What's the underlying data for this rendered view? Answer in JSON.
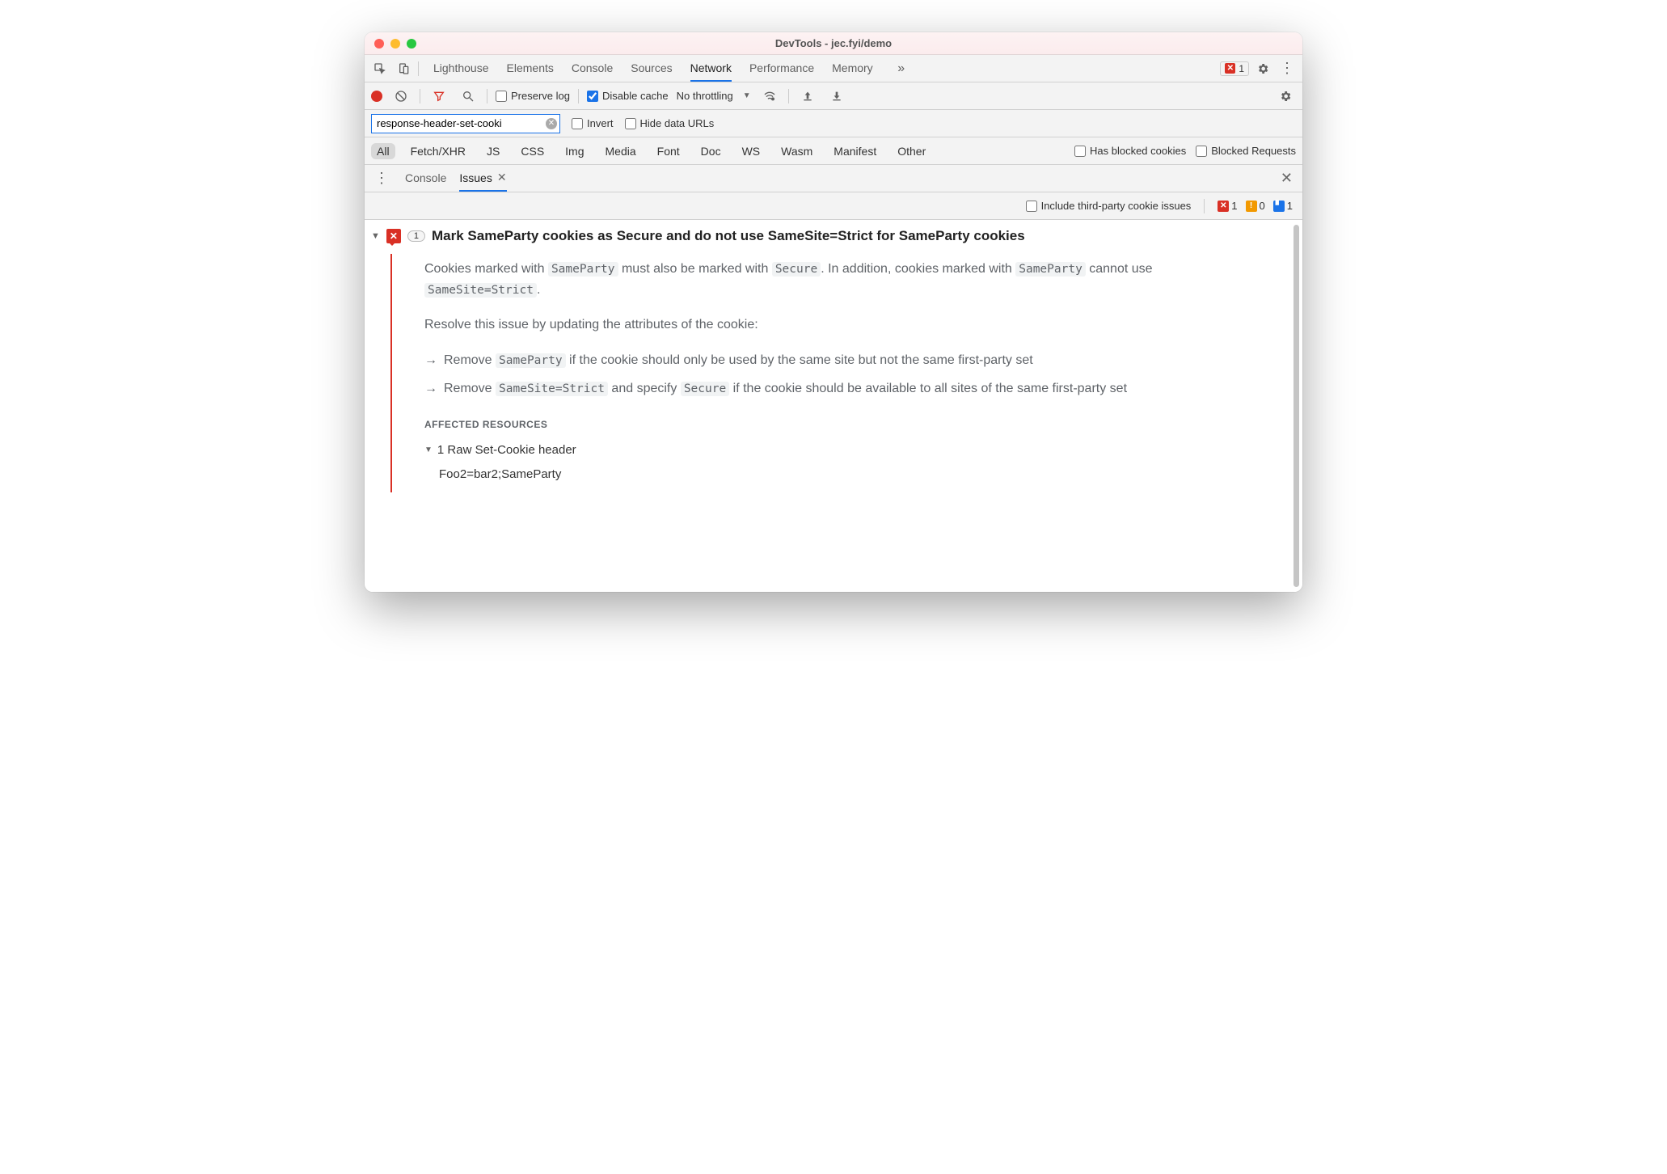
{
  "window": {
    "title": "DevTools - jec.fyi/demo"
  },
  "tabs": {
    "items": [
      "Lighthouse",
      "Elements",
      "Console",
      "Sources",
      "Network",
      "Performance",
      "Memory"
    ],
    "active": "Network",
    "more_icon": "chevrons-right-icon",
    "error_count": "1"
  },
  "network_toolbar": {
    "preserve_log_label": "Preserve log",
    "preserve_log_checked": false,
    "disable_cache_label": "Disable cache",
    "disable_cache_checked": true,
    "throttling": "No throttling"
  },
  "filter": {
    "input_value": "response-header-set-cooki",
    "invert_label": "Invert",
    "hide_data_urls_label": "Hide data URLs"
  },
  "type_filters": {
    "items": [
      "All",
      "Fetch/XHR",
      "JS",
      "CSS",
      "Img",
      "Media",
      "Font",
      "Doc",
      "WS",
      "Wasm",
      "Manifest",
      "Other"
    ],
    "active": "All",
    "has_blocked_cookies_label": "Has blocked cookies",
    "blocked_requests_label": "Blocked Requests"
  },
  "drawer": {
    "tabs": [
      "Console",
      "Issues"
    ],
    "active": "Issues"
  },
  "issues_bar": {
    "include_third_party_label": "Include third-party cookie issues",
    "counts": {
      "error": "1",
      "warning": "0",
      "info": "1"
    }
  },
  "issue": {
    "count": "1",
    "title": "Mark SameParty cookies as Secure and do not use SameSite=Strict for SameParty cookies",
    "p1_a": "Cookies marked with ",
    "p1_code1": "SameParty",
    "p1_b": " must also be marked with ",
    "p1_code2": "Secure",
    "p1_c": ". In addition, cookies marked with ",
    "p1_code3": "SameParty",
    "p1_d": " cannot use ",
    "p1_code4": "SameSite=Strict",
    "p1_e": ".",
    "p2": "Resolve this issue by updating the attributes of the cookie:",
    "b1_a": "Remove ",
    "b1_code": "SameParty",
    "b1_b": " if the cookie should only be used by the same site but not the same first-party set",
    "b2_a": "Remove ",
    "b2_code1": "SameSite=Strict",
    "b2_b": " and specify ",
    "b2_code2": "Secure",
    "b2_c": " if the cookie should be available to all sites of the same first-party set",
    "affected_heading": "Affected Resources",
    "raw_header_label": "1 Raw Set-Cookie header",
    "raw_header_value": "Foo2=bar2;SameParty"
  }
}
